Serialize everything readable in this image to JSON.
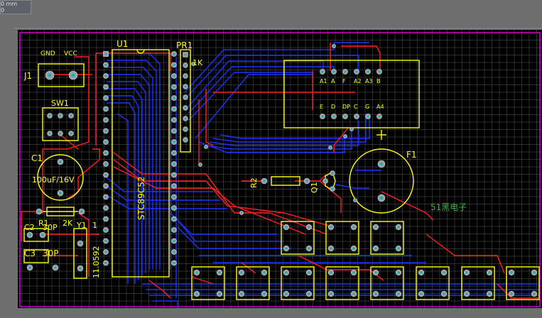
{
  "tooltip": {
    "lines": [
      "0 mm",
      "0"
    ]
  },
  "board": {
    "colors": {
      "background": "#000000",
      "grid": "#6a6a6a",
      "outline": "#ff00ff",
      "silkscreen": "#ffff00",
      "top_copper": "#ff2020",
      "bottom_copper": "#1e32ff",
      "pad": "#9aa0a6",
      "watermark": "#3cb043"
    },
    "labels": {
      "j1": "J1",
      "gnd": "GND",
      "vcc": "VCC",
      "sw1": "SW1",
      "c1": "C1",
      "c1_value": "100uF/16V",
      "r1": "R1",
      "r1_value": "2K",
      "c2": "C2",
      "c2_value": "30P",
      "c3": "C3",
      "c3_value": "30P",
      "y1": "Y1",
      "y1_suffix": "1",
      "crystal_value": "11.0592",
      "u1": "U1",
      "u1_value": "STC89C52",
      "pr1": "PR1",
      "pr1_value": "1K",
      "r2": "R2",
      "q1": "Q1",
      "f1": "F1",
      "f1_plus": "+",
      "display_top_pins": [
        "A1",
        "A",
        "F",
        "A2",
        "A3",
        "B"
      ],
      "display_bottom_pins": [
        "E",
        "D",
        "DP",
        "C",
        "G",
        "A4"
      ],
      "watermark": "51黑电子"
    }
  }
}
